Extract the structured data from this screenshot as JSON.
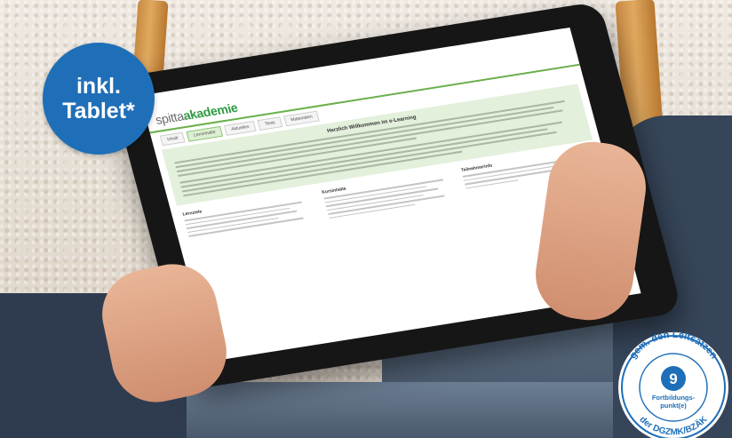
{
  "promo_badge": {
    "line1": "inkl.",
    "line2": "Tablet*",
    "color": "#1f6fb8"
  },
  "tablet_screen": {
    "brand_light": "spitta",
    "brand_bold": "akademie",
    "nav_tabs": [
      "Inhalt",
      "Lerninhalte",
      "Aktuelles",
      "Tests",
      "Materialien"
    ],
    "active_tab_index": 1,
    "welcome_heading": "Herzlich Willkommen im e-Learning",
    "col_headings": [
      "Lernziele",
      "Kursinhalte",
      "Teilnehmerinfo"
    ],
    "accent_color": "#6ab04c"
  },
  "seal": {
    "ring_text_top": "gem. den Leitsätzen",
    "ring_text_bottom": "der DGZMK/BZÄK",
    "points": "9",
    "points_label_1": "Fortbildungs-",
    "points_label_2": "punkt(e)",
    "color": "#1f6fb8"
  }
}
